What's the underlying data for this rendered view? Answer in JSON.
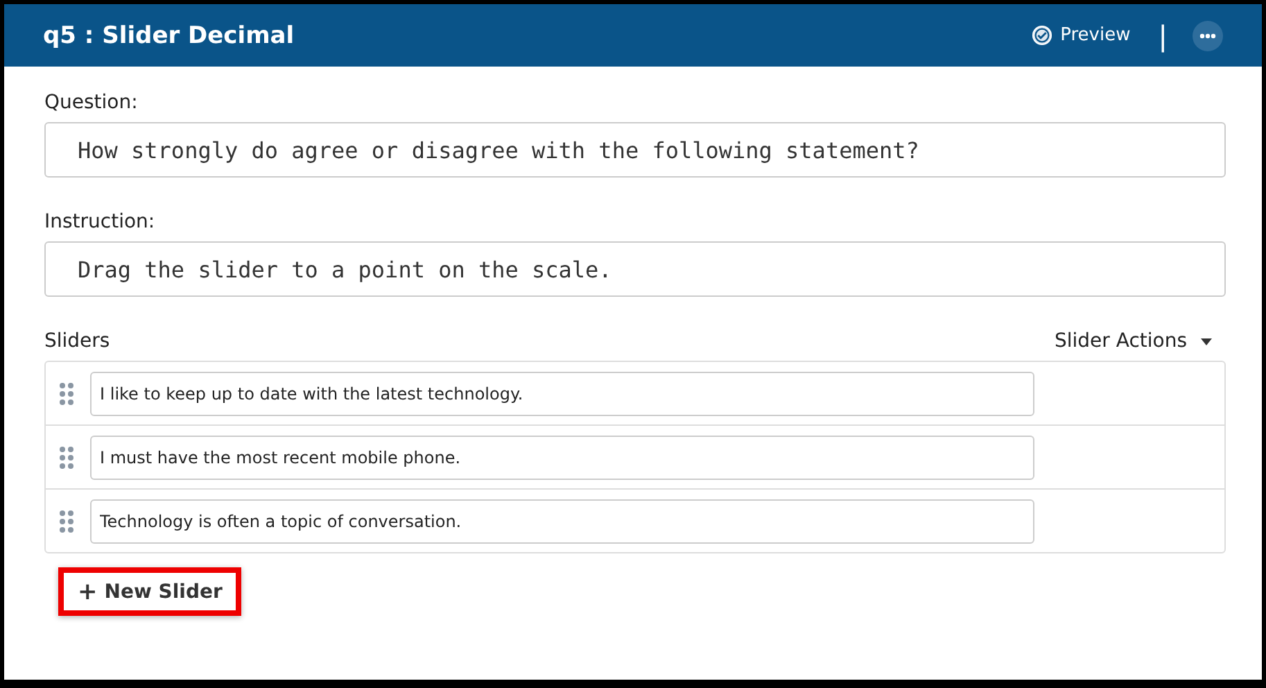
{
  "header": {
    "title": "q5 : Slider Decimal",
    "preview": "Preview",
    "divider": "|"
  },
  "question": {
    "label": "Question:",
    "value": "How strongly do agree or disagree with the following statement?"
  },
  "instruction": {
    "label": "Instruction:",
    "value": "Drag the slider to a point on the scale."
  },
  "sliders": {
    "label": "Sliders",
    "actions": "Slider Actions",
    "items": [
      {
        "value": "I like to keep up to date with the latest technology."
      },
      {
        "value": "I must have the most recent mobile phone."
      },
      {
        "value": "Technology is often a topic of conversation."
      }
    ]
  },
  "new_slider": {
    "plus": "+",
    "label": "New Slider",
    "highlighted": true
  }
}
